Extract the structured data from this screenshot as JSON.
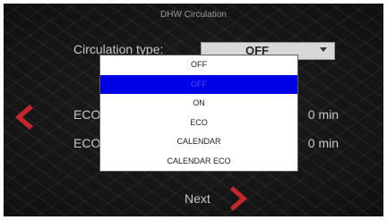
{
  "header": {
    "title": "DHW Circulation"
  },
  "form": {
    "circulation_label": "Circulation type:",
    "circulation_value": "OFF",
    "eco_label_1": "ECO",
    "eco_value_1": "0 min",
    "eco_label_2": "ECO",
    "eco_value_2": "0 min"
  },
  "dropdown": {
    "options": [
      "OFF",
      "OFF",
      "ON",
      "ECO",
      "CALENDAR",
      "CALENDAR ECO"
    ],
    "highlighted_index": 1
  },
  "nav": {
    "next_label": "Next"
  },
  "colors": {
    "accent_arrow": "#c0272d",
    "highlight": "#0000e6",
    "background": "#141414"
  },
  "icons": {
    "prev": "chevron-left-icon",
    "next": "chevron-right-icon",
    "caret": "caret-down-icon"
  }
}
